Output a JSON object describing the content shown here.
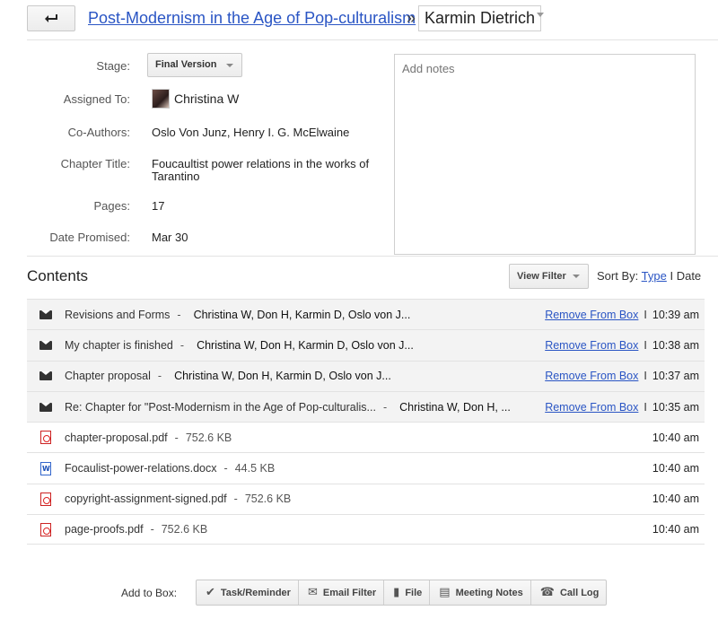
{
  "header": {
    "title": "Post-Modernism in the Age of Pop-culturalism",
    "separator": "»",
    "person": "Karmin Dietrich"
  },
  "details": {
    "stage_label": "Stage:",
    "stage_value": "Final Version",
    "assigned_label": "Assigned To:",
    "assigned_value": "Christina W",
    "coauthors_label": "Co-Authors:",
    "coauthors_value": "Oslo Von Junz, Henry I. G. McElwaine",
    "chapter_label": "Chapter Title:",
    "chapter_value_line1": "Foucaultist power relations in the works of",
    "chapter_value_line2": "Tarantino",
    "pages_label": "Pages:",
    "pages_value": "17",
    "date_label": "Date Promised:",
    "date_value": "Mar 30",
    "notes_placeholder": "Add notes"
  },
  "contents": {
    "title": "Contents",
    "view_filter": "View Filter",
    "sort_by": "Sort By:",
    "sort_type": "Type",
    "sort_sep": "I",
    "sort_date": "Date",
    "remove_label": "Remove From Box",
    "bar": "I",
    "dash": "-",
    "mails": [
      {
        "subject": "Revisions and Forms",
        "people": "Christina W, Don H, Karmin D, Oslo von J...",
        "time": "10:39 am"
      },
      {
        "subject": "My chapter is finished",
        "people": "Christina W, Don H, Karmin D, Oslo von J...",
        "time": "10:38 am"
      },
      {
        "subject": "Chapter proposal",
        "people": "Christina W, Don H, Karmin D, Oslo von J...",
        "time": "10:37 am"
      },
      {
        "subject": "Re: Chapter for \"Post-Modernism in the Age of Pop-culturalis...",
        "people": "Christina W, Don H, ...",
        "time": "10:35 am"
      }
    ],
    "files": [
      {
        "name": "chapter-proposal.pdf",
        "size": "752.6 KB",
        "time": "10:40 am",
        "icon": "pdf-icon"
      },
      {
        "name": "Focaulist-power-relations.docx",
        "size": "44.5 KB",
        "time": "10:40 am",
        "icon": "word-doc-icon"
      },
      {
        "name": "copyright-assignment-signed.pdf",
        "size": "752.6 KB",
        "time": "10:40 am",
        "icon": "pdf-icon"
      },
      {
        "name": "page-proofs.pdf",
        "size": "752.6 KB",
        "time": "10:40 am",
        "icon": "pdf-icon"
      }
    ]
  },
  "add_to_box": {
    "label": "Add to Box:",
    "buttons": [
      {
        "label": "Task/Reminder",
        "icon": "checkmark-icon"
      },
      {
        "label": "Email Filter",
        "icon": "email-filter-icon"
      },
      {
        "label": "File",
        "icon": "file-icon"
      },
      {
        "label": "Meeting Notes",
        "icon": "notes-icon"
      },
      {
        "label": "Call Log",
        "icon": "phone-icon"
      }
    ]
  }
}
